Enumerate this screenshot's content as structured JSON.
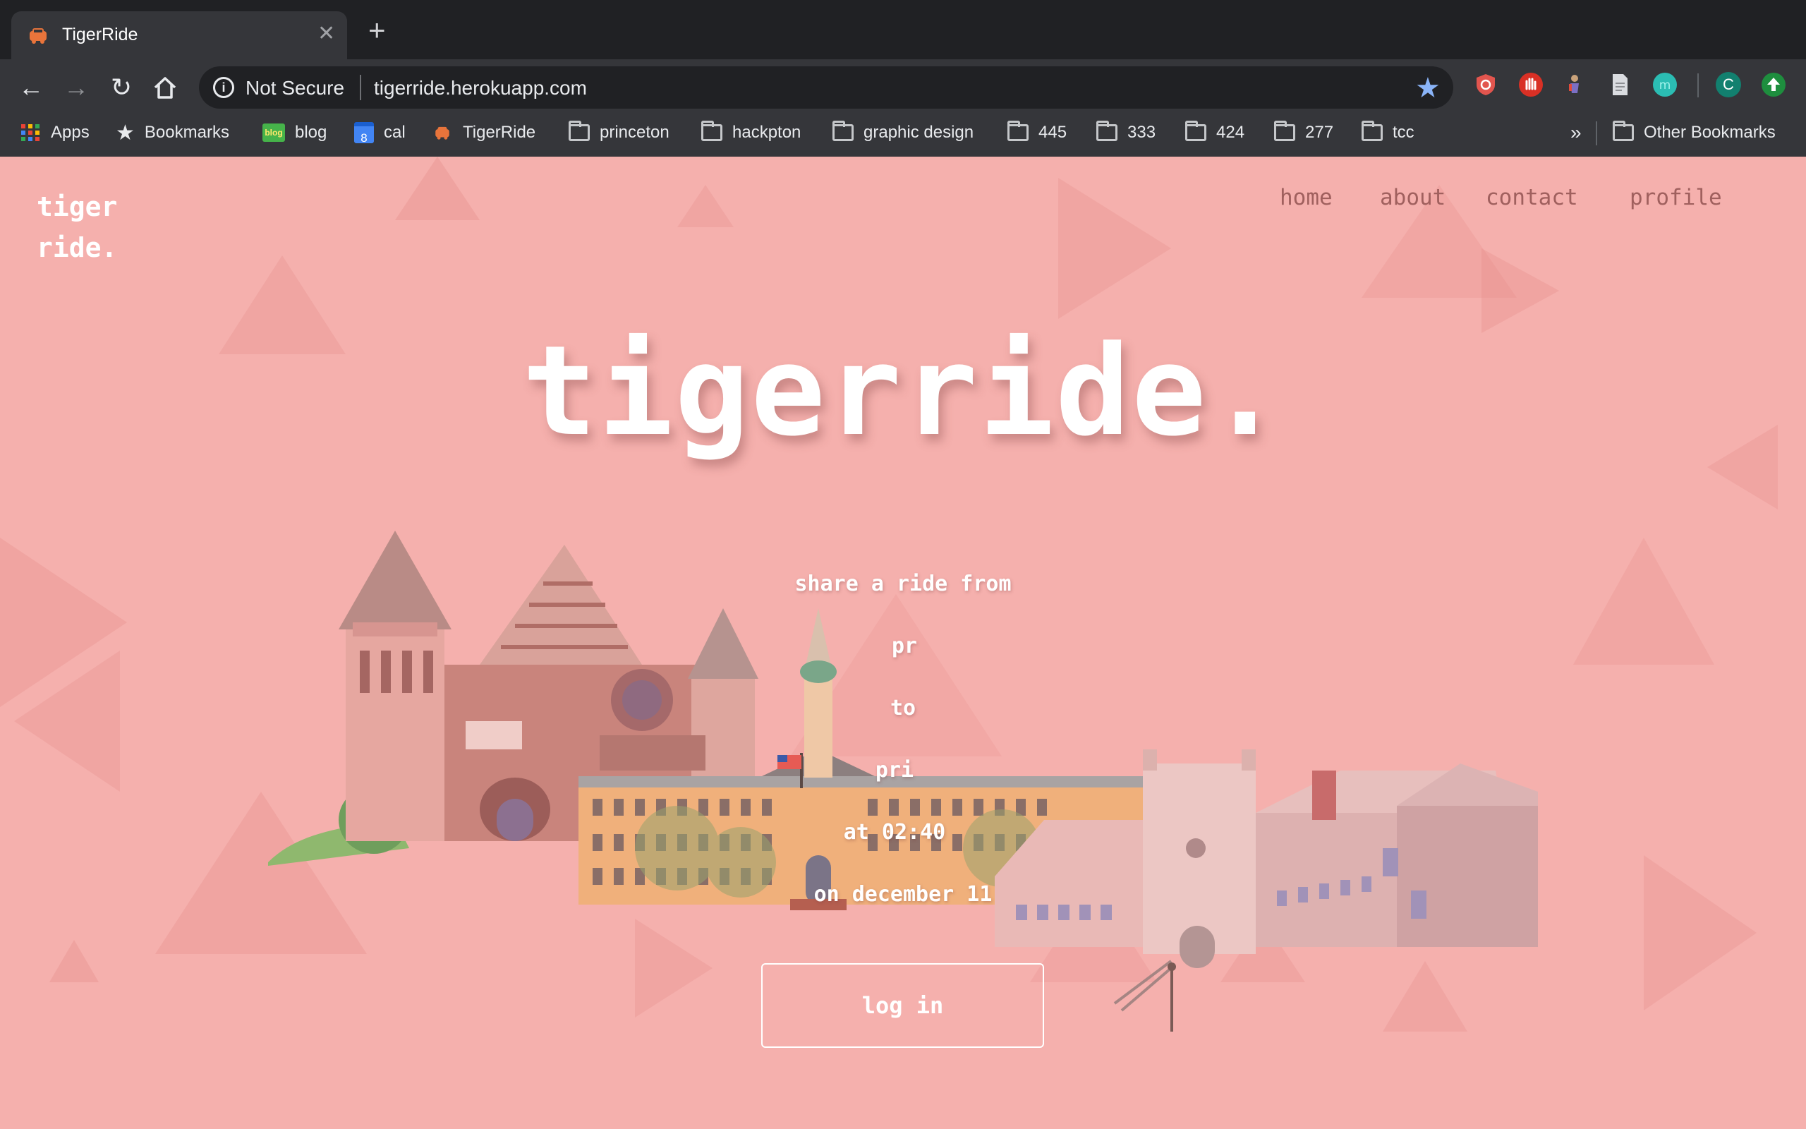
{
  "browser": {
    "tab_title": "TigerRide",
    "security_label": "Not Secure",
    "url": "tigerride.herokuapp.com",
    "extension_avatar_letter": "C",
    "bookmarks": [
      {
        "label": "Apps",
        "icon": "apps-grid-icon"
      },
      {
        "label": "Bookmarks",
        "icon": "star-icon"
      },
      {
        "label": "blog",
        "icon": "blog-favicon"
      },
      {
        "label": "cal",
        "icon": "calendar-favicon"
      },
      {
        "label": "TigerRide",
        "icon": "tigerride-favicon"
      },
      {
        "label": "princeton",
        "icon": "folder-icon"
      },
      {
        "label": "hackpton",
        "icon": "folder-icon"
      },
      {
        "label": "graphic design",
        "icon": "folder-icon"
      },
      {
        "label": "445",
        "icon": "folder-icon"
      },
      {
        "label": "333",
        "icon": "folder-icon"
      },
      {
        "label": "424",
        "icon": "folder-icon"
      },
      {
        "label": "277",
        "icon": "folder-icon"
      },
      {
        "label": "tcc",
        "icon": "folder-icon"
      }
    ],
    "overflow_label": "»",
    "other_bookmarks": "Other Bookmarks",
    "calendar_day": "8",
    "blog_favicon_text": "blog"
  },
  "site": {
    "logo_line1": "tiger",
    "logo_line2": "ride.",
    "nav": [
      "home",
      "about",
      "contact",
      "profile"
    ],
    "hero_title": "tigerride.",
    "share_line": "share a ride from",
    "origin": "pr",
    "to_label": "to",
    "destination": "pri",
    "time_line": "at 02:40",
    "date_line": "on december 11",
    "login_label": "log in"
  },
  "colors": {
    "background": "#f5b0ad",
    "nav_text": "#a0605e",
    "chrome_dark": "#202124",
    "chrome_toolbar": "#35363a"
  }
}
